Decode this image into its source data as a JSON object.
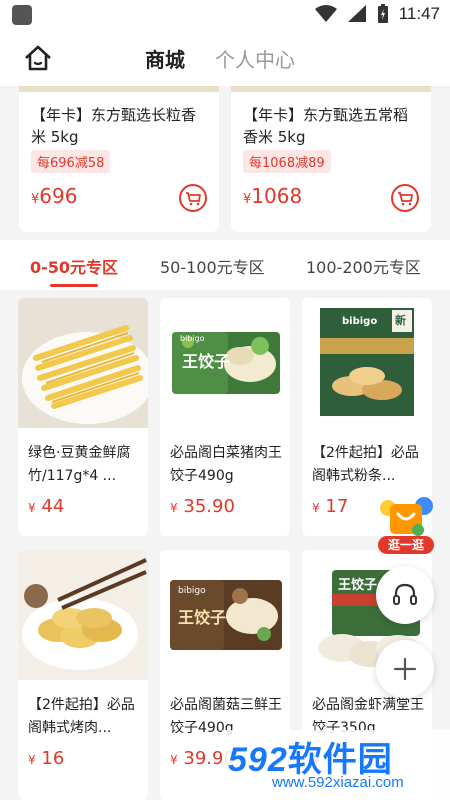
{
  "status": {
    "time": "11:47"
  },
  "nav": {
    "tab_shop": "商城",
    "tab_me": "个人中心"
  },
  "featured": [
    {
      "title": "【年卡】东方甄选长粒香米 5kg",
      "badge": "每696减58",
      "currency": "¥",
      "price": "696"
    },
    {
      "title": "【年卡】东方甄选五常稻香米 5kg",
      "badge": "每1068减89",
      "currency": "¥",
      "price": "1068"
    }
  ],
  "zones": [
    "0-50元专区",
    "50-100元专区",
    "100-200元专区"
  ],
  "products": [
    {
      "title": "绿色·豆黄金鲜腐竹/117g*4 ...",
      "currency": "¥",
      "price": "44"
    },
    {
      "title": "必品阁白菜猪肉王饺子490g",
      "currency": "¥",
      "price": "35.90"
    },
    {
      "title": "【2件起拍】必品阁韩式粉条...",
      "currency": "¥",
      "price": "17"
    },
    {
      "title": "【2件起拍】必品阁韩式烤肉...",
      "currency": "¥",
      "price": "16"
    },
    {
      "title": "必品阁菌菇三鲜王饺子490g",
      "currency": "¥",
      "price": "39.90"
    },
    {
      "title": "必品阁金虾满堂王饺子350g",
      "currency": "¥",
      "price": ""
    }
  ],
  "float": {
    "browse_label": "逛一逛"
  },
  "watermark": {
    "brand_num": "592",
    "brand_cn": "软件园",
    "url": "www.592xiazai.com"
  },
  "colors": {
    "accent": "#e0392b",
    "brand_blue": "#1677ff"
  },
  "package_texts": {
    "wang": "王饺子",
    "bibigo": "bibigo",
    "xin": "新"
  }
}
